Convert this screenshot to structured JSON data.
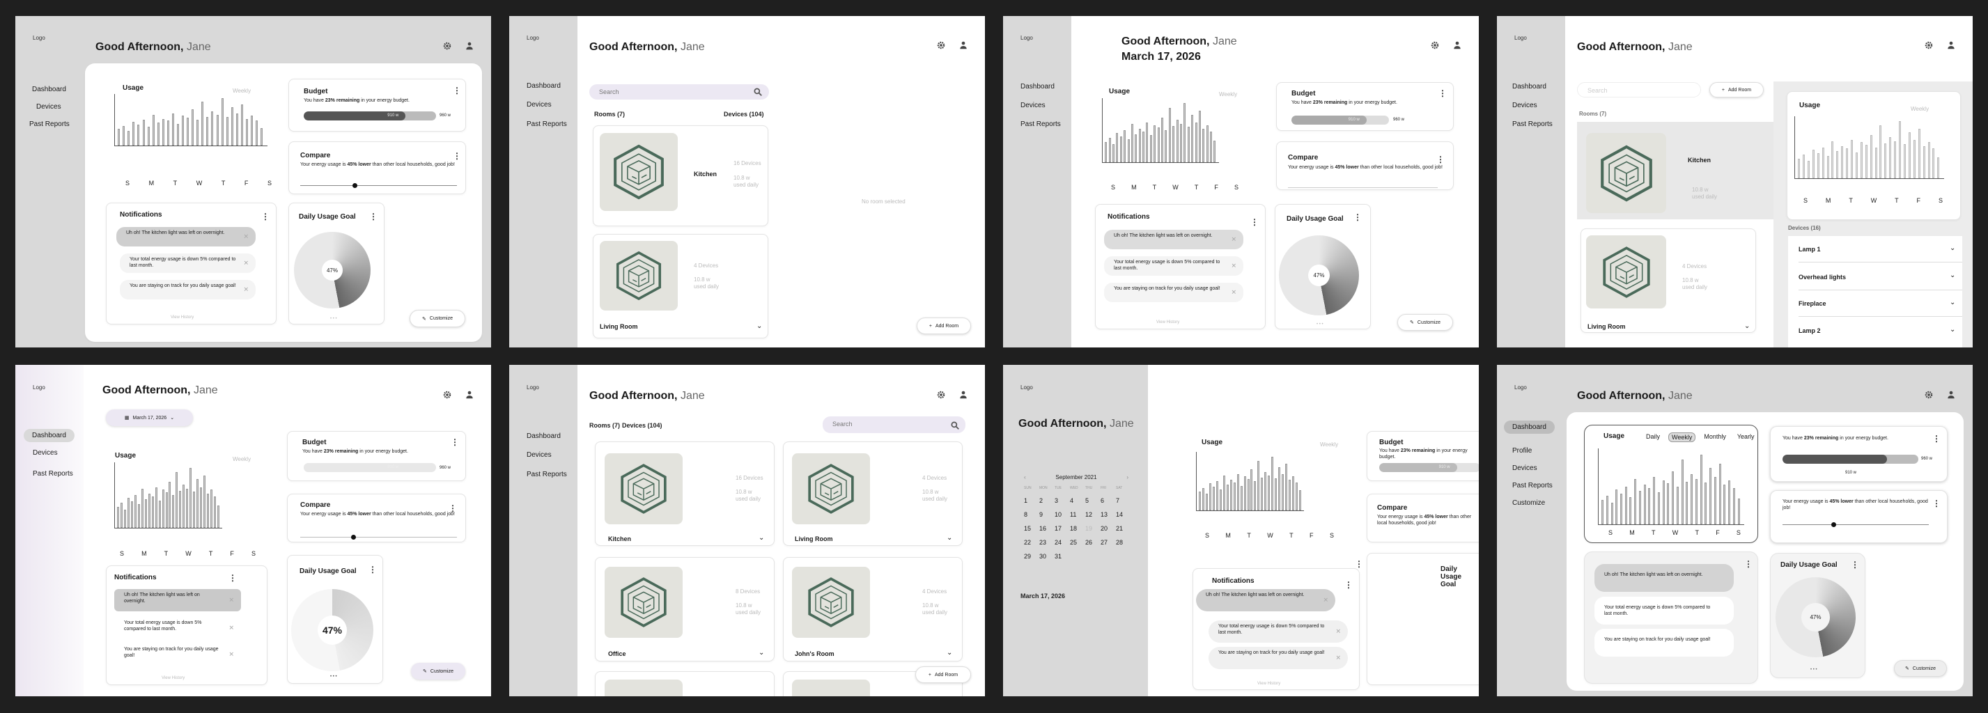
{
  "app": {
    "logo": "Logo",
    "greeting": "Good Afternoon,",
    "user": "Jane",
    "date": "March 17, 2026"
  },
  "nav": {
    "dashboard": "Dashboard",
    "devices": "Devices",
    "past_reports": "Past Reports",
    "profile": "Profile",
    "customize": "Customize"
  },
  "usage": {
    "title": "Usage",
    "period": "Weekly",
    "tabs": [
      "Daily",
      "Weekly",
      "Monthly",
      "Yearly"
    ],
    "days": [
      "S",
      "M",
      "T",
      "W",
      "T",
      "F",
      "S"
    ],
    "levels": [
      0.32,
      0.38,
      0.28,
      0.46,
      0.4,
      0.5,
      0.36,
      0.6,
      0.44,
      0.52,
      0.48,
      0.62,
      0.42,
      0.58,
      0.54,
      0.7,
      0.5,
      0.85,
      0.56,
      0.66,
      0.6,
      0.92,
      0.55,
      0.74,
      0.62,
      0.8,
      0.52,
      0.58,
      0.48,
      0.34
    ]
  },
  "budget": {
    "title": "Budget",
    "pre": "You have ",
    "pct": "23% remaining",
    "post": " in your energy budget.",
    "used": "910 w",
    "limit": "960 w",
    "fraction": 0.77
  },
  "compare": {
    "title": "Compare",
    "pre": "Your energy usage is ",
    "pct": "45% lower",
    "post": " than other local households, good job!"
  },
  "notifications": {
    "title": "Notifications",
    "items": [
      "Uh oh! The kitchen light was left on overnight.",
      "Your total energy usage is down 5% compared to last month.",
      "You are staying on track for you daily usage goal!"
    ],
    "view_history": "View History"
  },
  "goal": {
    "title": "Daily Usage Goal",
    "value": "47%",
    "fraction": 0.47
  },
  "customize_label": "Customize",
  "devices_page": {
    "search_placeholder": "Search",
    "rooms_label": "Rooms (7)",
    "devices_label": "Devices (104)",
    "devices_label_short": "Devices (16)",
    "no_room": "No room selected",
    "add_room": "Add Room",
    "rooms": [
      {
        "name": "Kitchen",
        "devices": "16 Devices",
        "rate": "10.8 w",
        "note": "used daily"
      },
      {
        "name": "Living Room",
        "devices": "4 Devices",
        "rate": "10.8 w",
        "note": "used daily"
      },
      {
        "name": "Office",
        "devices": "8 Devices",
        "rate": "10.8 w",
        "note": "used daily"
      },
      {
        "name": "John's Room",
        "devices": "4 Devices",
        "rate": "10.8 w",
        "note": "used daily"
      }
    ],
    "device_list": [
      "Lamp 1",
      "Overhead lights",
      "Fireplace",
      "Lamp 2"
    ]
  },
  "calendar": {
    "month": "September 2021",
    "weekdays": [
      "SUN",
      "MON",
      "TUE",
      "WED",
      "THU",
      "FRI",
      "SAT"
    ],
    "days": [
      "1",
      "2",
      "3",
      "4",
      "5",
      "6",
      "7",
      "8",
      "9",
      "10",
      "11",
      "12",
      "13",
      "14",
      "15",
      "16",
      "17",
      "18",
      "19",
      "20",
      "21",
      "22",
      "23",
      "24",
      "25",
      "26",
      "27",
      "28",
      "29",
      "30",
      "31"
    ],
    "selected_label": "March 17, 2026"
  },
  "colors": {
    "sidebar": "#d9d9d9",
    "search": "#ece8f3",
    "hex": "#e3e3dd",
    "room_icon": "#4a6a5a"
  }
}
